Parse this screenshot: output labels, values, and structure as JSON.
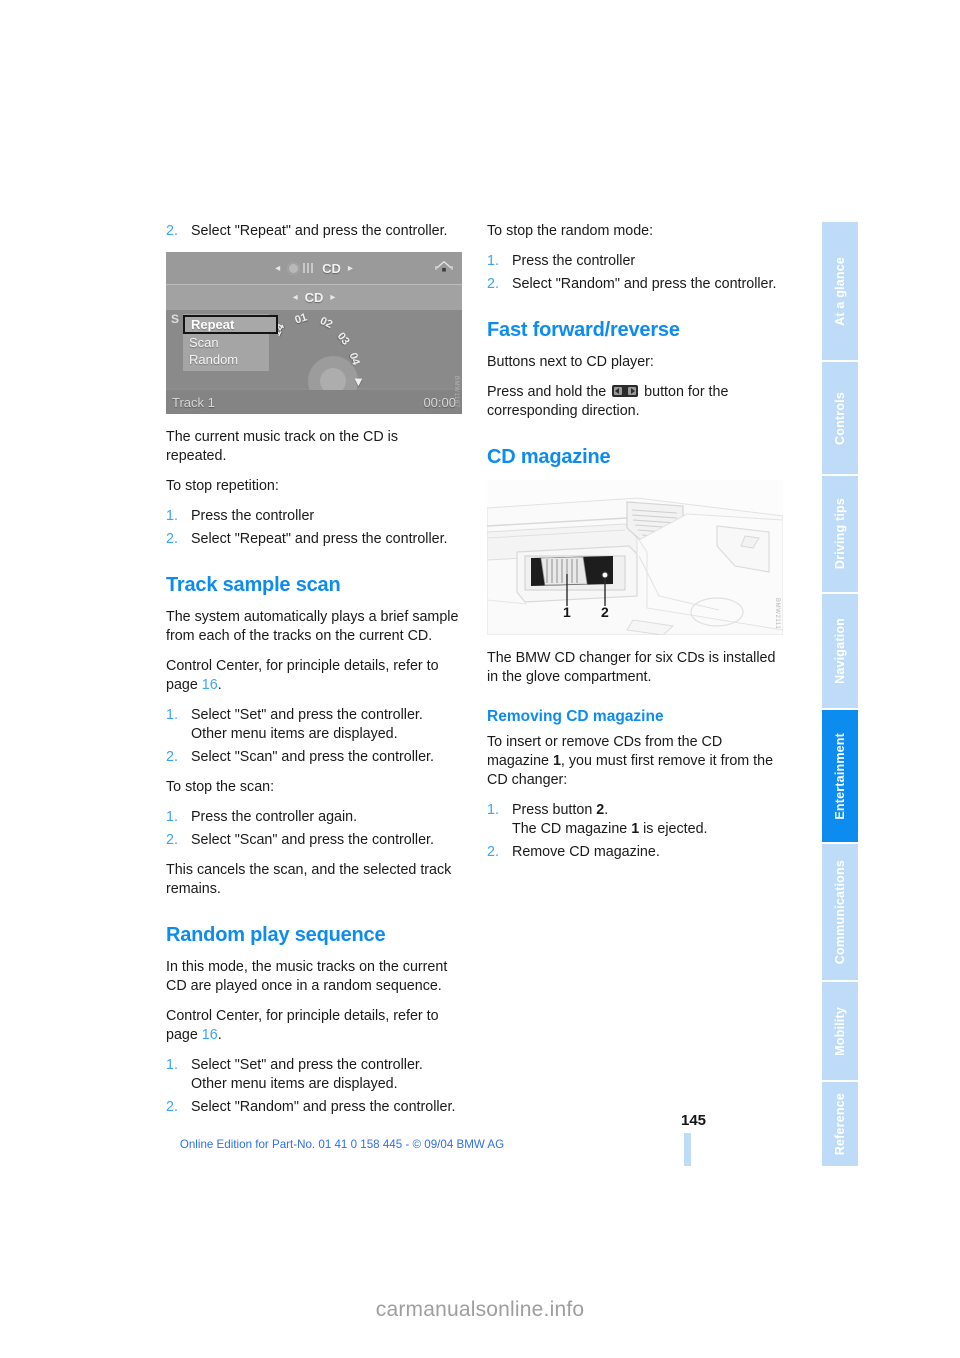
{
  "document": {
    "page_number": "145",
    "credit": "Online Edition for Part-No. 01 41 0 158 445 - © 09/04 BMW AG",
    "watermark": "carmanualsonline.info"
  },
  "tabs": [
    {
      "label": "At a glance",
      "active": false
    },
    {
      "label": "Controls",
      "active": false
    },
    {
      "label": "Driving tips",
      "active": false
    },
    {
      "label": "Navigation",
      "active": false
    },
    {
      "label": "Entertainment",
      "active": true
    },
    {
      "label": "Communications",
      "active": false
    },
    {
      "label": "Mobility",
      "active": false
    },
    {
      "label": "Reference",
      "active": false
    }
  ],
  "colors": {
    "accent_blue": "#0d8cf0",
    "tab_inactive": "#bedcf8",
    "step_number": "#3da4f5",
    "credit_blue": "#2f6ff0"
  },
  "left_column": {
    "repeat_step2_num": "2.",
    "repeat_step2_text": "Select \"Repeat\" and press the controller.",
    "figure_cd_screen": {
      "name": "idrive-cd-repeat-menu",
      "header_label": "CD",
      "subheader_label": "CD",
      "menu_items": [
        "Repeat",
        "Scan",
        "Random"
      ],
      "selected_menu_item": "Repeat",
      "dial_numbers": [
        "14",
        "01",
        "02",
        "03",
        "04"
      ],
      "status_left": "Track 1",
      "status_right": "00:00",
      "side_letter": "S",
      "picture_code": "BMW1187"
    },
    "p_repeated": "The current music track on the CD is repeated.",
    "p_to_stop_repetition": "To stop repetition:",
    "stop_repetition_steps": [
      {
        "num": "1.",
        "text": "Press the controller"
      },
      {
        "num": "2.",
        "text": "Select \"Repeat\" and press the controller."
      }
    ],
    "h_track_sample_scan": "Track sample scan",
    "p_scan_intro": "The system automatically plays a brief sample from each of the tracks on the current CD.",
    "p_scan_control_center_a": "Control Center, for principle details, refer to page ",
    "p_scan_control_center_page": "16",
    "p_scan_control_center_b": ".",
    "scan_steps": [
      {
        "num": "1.",
        "text": "Select \"Set\" and press the controller.",
        "sub": "Other menu items are displayed."
      },
      {
        "num": "2.",
        "text": "Select \"Scan\" and press the controller.",
        "sub": ""
      }
    ],
    "p_to_stop_scan": "To stop the scan:",
    "stop_scan_steps": [
      {
        "num": "1.",
        "text": "Press the controller again.",
        "sub": ""
      },
      {
        "num": "2.",
        "text": "Select \"Scan\" and press the controller.",
        "sub": ""
      }
    ],
    "p_cancels_scan": "This cancels the scan, and the selected track remains.",
    "h_random_play": "Random play sequence",
    "p_random_intro": "In this mode, the music tracks on the current CD are played once in a random sequence.",
    "p_random_control_center_a": "Control Center, for principle details, refer to page ",
    "p_random_control_center_page": "16",
    "p_random_control_center_b": ".",
    "random_steps": [
      {
        "num": "1.",
        "text": "Select \"Set\" and press the controller.",
        "sub": "Other menu items are displayed."
      },
      {
        "num": "2.",
        "text": "Select \"Random\" and press the controller.",
        "sub": ""
      }
    ]
  },
  "right_column": {
    "p_to_stop_random": "To stop the random mode:",
    "stop_random_steps": [
      {
        "num": "1.",
        "text": "Press the controller"
      },
      {
        "num": "2.",
        "text": "Select \"Random\" and press the controller."
      }
    ],
    "h_fast_forward": "Fast forward/reverse",
    "p_buttons_next": "Buttons next to CD player:",
    "p_press_hold_a": "Press and hold the ",
    "p_press_hold_b": " button for the corresponding direction.",
    "h_cd_magazine": "CD magazine",
    "figure_cd_magazine": {
      "name": "cd-changer-glove-compartment",
      "callouts": [
        "1",
        "2"
      ],
      "picture_code": "BMW2111"
    },
    "p_bmw_changer": "The BMW CD changer for six CDs is installed in the glove compartment.",
    "h_removing_cd_magazine": "Removing CD magazine",
    "p_removing_intro_a": "To insert or remove CDs from the CD magazine ",
    "p_removing_intro_bold": "1",
    "p_removing_intro_b": ", you must first remove it from the CD changer:",
    "removing_steps": [
      {
        "num": "1.",
        "text_a": "Press button ",
        "bold": "2",
        "text_b": ".",
        "sub_a": "The CD magazine ",
        "sub_bold": "1",
        "sub_b": " is ejected."
      },
      {
        "num": "2.",
        "text_a": "Remove CD magazine.",
        "bold": "",
        "text_b": "",
        "sub_a": "",
        "sub_bold": "",
        "sub_b": ""
      }
    ]
  }
}
